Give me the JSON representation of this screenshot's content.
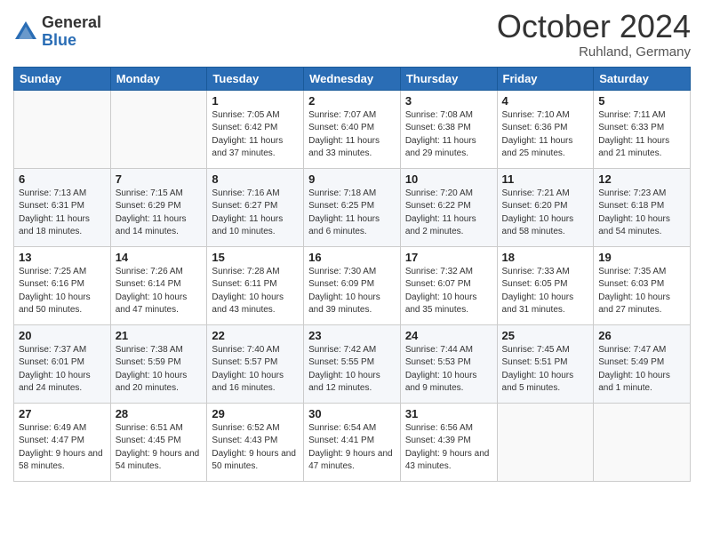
{
  "logo": {
    "general": "General",
    "blue": "Blue"
  },
  "header": {
    "month": "October 2024",
    "location": "Ruhland, Germany"
  },
  "weekdays": [
    "Sunday",
    "Monday",
    "Tuesday",
    "Wednesday",
    "Thursday",
    "Friday",
    "Saturday"
  ],
  "weeks": [
    [
      {
        "day": "",
        "info": ""
      },
      {
        "day": "",
        "info": ""
      },
      {
        "day": "1",
        "info": "Sunrise: 7:05 AM\nSunset: 6:42 PM\nDaylight: 11 hours and 37 minutes."
      },
      {
        "day": "2",
        "info": "Sunrise: 7:07 AM\nSunset: 6:40 PM\nDaylight: 11 hours and 33 minutes."
      },
      {
        "day": "3",
        "info": "Sunrise: 7:08 AM\nSunset: 6:38 PM\nDaylight: 11 hours and 29 minutes."
      },
      {
        "day": "4",
        "info": "Sunrise: 7:10 AM\nSunset: 6:36 PM\nDaylight: 11 hours and 25 minutes."
      },
      {
        "day": "5",
        "info": "Sunrise: 7:11 AM\nSunset: 6:33 PM\nDaylight: 11 hours and 21 minutes."
      }
    ],
    [
      {
        "day": "6",
        "info": "Sunrise: 7:13 AM\nSunset: 6:31 PM\nDaylight: 11 hours and 18 minutes."
      },
      {
        "day": "7",
        "info": "Sunrise: 7:15 AM\nSunset: 6:29 PM\nDaylight: 11 hours and 14 minutes."
      },
      {
        "day": "8",
        "info": "Sunrise: 7:16 AM\nSunset: 6:27 PM\nDaylight: 11 hours and 10 minutes."
      },
      {
        "day": "9",
        "info": "Sunrise: 7:18 AM\nSunset: 6:25 PM\nDaylight: 11 hours and 6 minutes."
      },
      {
        "day": "10",
        "info": "Sunrise: 7:20 AM\nSunset: 6:22 PM\nDaylight: 11 hours and 2 minutes."
      },
      {
        "day": "11",
        "info": "Sunrise: 7:21 AM\nSunset: 6:20 PM\nDaylight: 10 hours and 58 minutes."
      },
      {
        "day": "12",
        "info": "Sunrise: 7:23 AM\nSunset: 6:18 PM\nDaylight: 10 hours and 54 minutes."
      }
    ],
    [
      {
        "day": "13",
        "info": "Sunrise: 7:25 AM\nSunset: 6:16 PM\nDaylight: 10 hours and 50 minutes."
      },
      {
        "day": "14",
        "info": "Sunrise: 7:26 AM\nSunset: 6:14 PM\nDaylight: 10 hours and 47 minutes."
      },
      {
        "day": "15",
        "info": "Sunrise: 7:28 AM\nSunset: 6:11 PM\nDaylight: 10 hours and 43 minutes."
      },
      {
        "day": "16",
        "info": "Sunrise: 7:30 AM\nSunset: 6:09 PM\nDaylight: 10 hours and 39 minutes."
      },
      {
        "day": "17",
        "info": "Sunrise: 7:32 AM\nSunset: 6:07 PM\nDaylight: 10 hours and 35 minutes."
      },
      {
        "day": "18",
        "info": "Sunrise: 7:33 AM\nSunset: 6:05 PM\nDaylight: 10 hours and 31 minutes."
      },
      {
        "day": "19",
        "info": "Sunrise: 7:35 AM\nSunset: 6:03 PM\nDaylight: 10 hours and 27 minutes."
      }
    ],
    [
      {
        "day": "20",
        "info": "Sunrise: 7:37 AM\nSunset: 6:01 PM\nDaylight: 10 hours and 24 minutes."
      },
      {
        "day": "21",
        "info": "Sunrise: 7:38 AM\nSunset: 5:59 PM\nDaylight: 10 hours and 20 minutes."
      },
      {
        "day": "22",
        "info": "Sunrise: 7:40 AM\nSunset: 5:57 PM\nDaylight: 10 hours and 16 minutes."
      },
      {
        "day": "23",
        "info": "Sunrise: 7:42 AM\nSunset: 5:55 PM\nDaylight: 10 hours and 12 minutes."
      },
      {
        "day": "24",
        "info": "Sunrise: 7:44 AM\nSunset: 5:53 PM\nDaylight: 10 hours and 9 minutes."
      },
      {
        "day": "25",
        "info": "Sunrise: 7:45 AM\nSunset: 5:51 PM\nDaylight: 10 hours and 5 minutes."
      },
      {
        "day": "26",
        "info": "Sunrise: 7:47 AM\nSunset: 5:49 PM\nDaylight: 10 hours and 1 minute."
      }
    ],
    [
      {
        "day": "27",
        "info": "Sunrise: 6:49 AM\nSunset: 4:47 PM\nDaylight: 9 hours and 58 minutes."
      },
      {
        "day": "28",
        "info": "Sunrise: 6:51 AM\nSunset: 4:45 PM\nDaylight: 9 hours and 54 minutes."
      },
      {
        "day": "29",
        "info": "Sunrise: 6:52 AM\nSunset: 4:43 PM\nDaylight: 9 hours and 50 minutes."
      },
      {
        "day": "30",
        "info": "Sunrise: 6:54 AM\nSunset: 4:41 PM\nDaylight: 9 hours and 47 minutes."
      },
      {
        "day": "31",
        "info": "Sunrise: 6:56 AM\nSunset: 4:39 PM\nDaylight: 9 hours and 43 minutes."
      },
      {
        "day": "",
        "info": ""
      },
      {
        "day": "",
        "info": ""
      }
    ]
  ]
}
